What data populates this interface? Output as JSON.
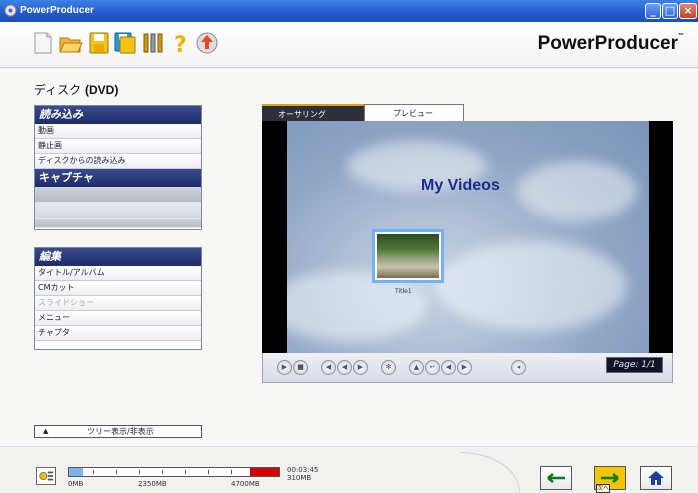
{
  "window": {
    "title": "PowerProducer"
  },
  "toolbar": {
    "icons": [
      "new-project-icon",
      "open-folder-icon",
      "save-icon",
      "save-as-icon",
      "settings-icon",
      "help-icon",
      "update-icon"
    ],
    "brand": "PowerProducer"
  },
  "disc": {
    "title_prefix": "ディスク",
    "title_type": "(DVD)"
  },
  "import_panel": {
    "header": "読み込み",
    "items": [
      "動画",
      "静止画",
      "ディスクからの読み込み"
    ]
  },
  "capture_panel": {
    "header": "キャプチャ"
  },
  "edit_panel": {
    "header": "編集",
    "items": [
      "タイトル/アルバム",
      "CMカット",
      "スライドショー",
      "メニュー",
      "チャプタ"
    ]
  },
  "tree_toggle": {
    "label": "ツリー表示/非表示"
  },
  "preview": {
    "tabs": [
      "オーサリング",
      "プレビュー"
    ],
    "menu_title": "My Videos",
    "thumb_label": "Title1",
    "page": "Page: 1/1"
  },
  "capacity": {
    "labels": [
      "0MB",
      "2350MB",
      "4700MB"
    ],
    "time": "00:03:45",
    "size": "310MB"
  },
  "nav": {
    "next_tooltip": "次へ"
  },
  "colors": {
    "accent_yellow": "#f5c400",
    "overflow_red": "#d40000",
    "title_blue": "#1a2c8c"
  }
}
